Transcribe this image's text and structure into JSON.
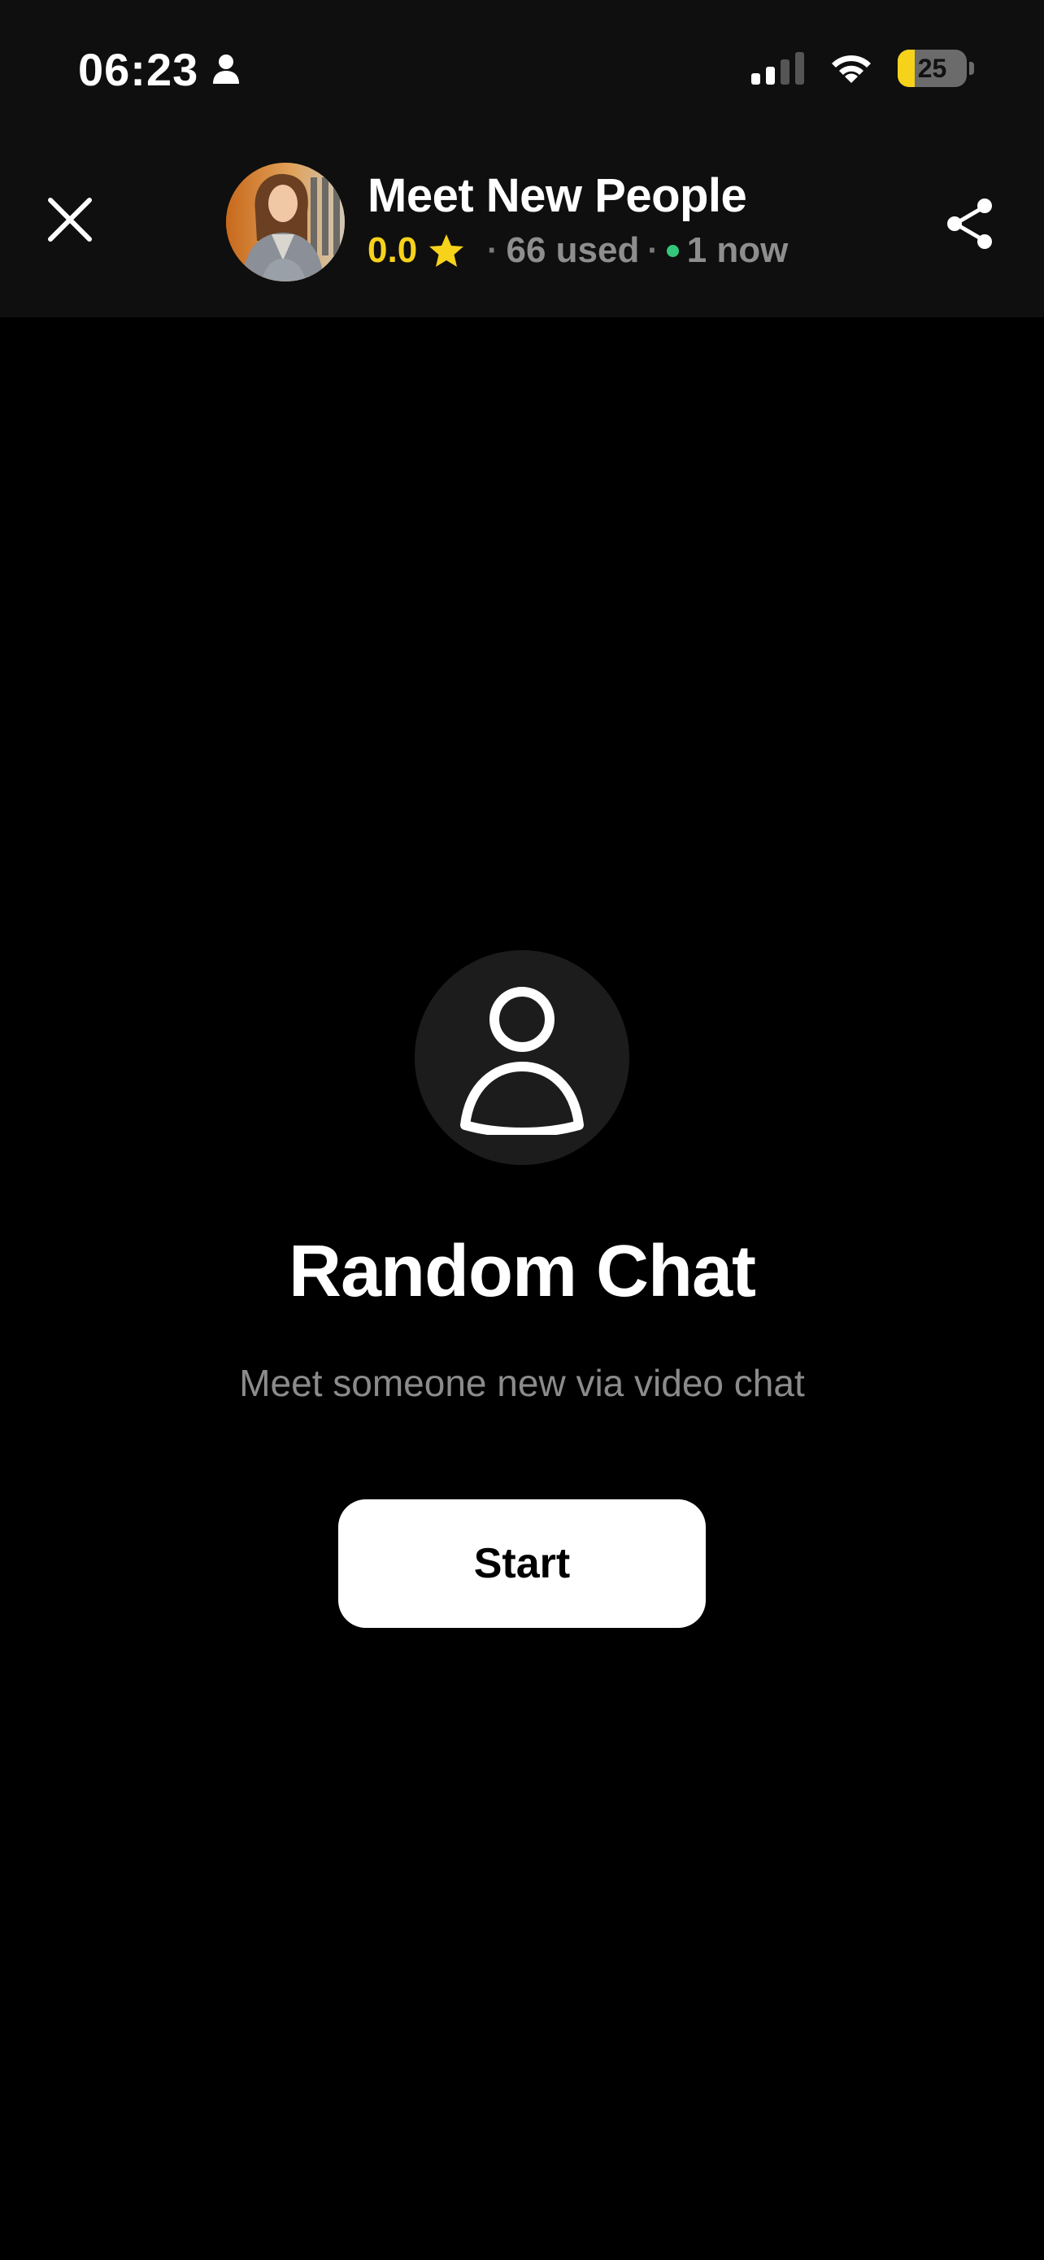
{
  "status_bar": {
    "time": "06:23",
    "battery_level": "25",
    "battery_fraction": 0.25,
    "icons": [
      "person-icon",
      "signal-icon",
      "wifi-icon",
      "battery-icon"
    ]
  },
  "header": {
    "close_icon": "close-icon",
    "title": "Meet New People",
    "rating": "0.0",
    "separator": "·",
    "used": "66 used",
    "online": "1 now",
    "share_icon": "share-icon"
  },
  "main": {
    "icon": "person-icon",
    "heading": "Random Chat",
    "subtitle": "Meet someone new via video chat",
    "start_label": "Start"
  },
  "colors": {
    "background": "#000000",
    "header_background": "#0f0f0f",
    "accent_yellow": "#f7d21b",
    "online_green": "#34c77b",
    "muted_text": "#8b8b8b",
    "icon_circle": "#1c1c1c",
    "button_background": "#ffffff"
  }
}
